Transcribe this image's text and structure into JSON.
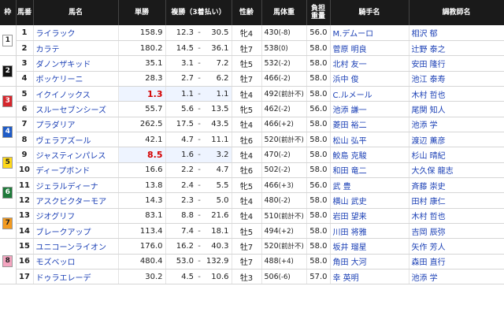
{
  "headers": {
    "waku": "枠",
    "umaban": "馬番",
    "horse": "馬名",
    "odds": "単勝",
    "place": "複勝（3着払い）",
    "sexage": "性齢",
    "weight": "馬体重",
    "kinryo_line1": "負担",
    "kinryo_line2": "重量",
    "jockey": "騎手名",
    "trainer": "調教師名"
  },
  "colors": {
    "waku1": "#ffffff",
    "waku2": "#111111",
    "waku3": "#d6262c",
    "waku4": "#1f5bc6",
    "waku5": "#ffd91a",
    "waku6": "#1f7a3a",
    "waku7": "#f39a1f",
    "waku8": "#f4a5c0"
  },
  "rows": [
    {
      "waku": "1",
      "waku_bg": "#ffffff",
      "waku_fg": "#222",
      "num": "1",
      "horse": "ライラック",
      "odds": "158.9",
      "p1": "12.3",
      "p2": "30.5",
      "sexage": "牝4",
      "w": "430",
      "wd": "(-8)",
      "kin": "56.0",
      "jockey": "M.デムーロ",
      "trainer": "相沢 郁",
      "red": false
    },
    {
      "waku": "",
      "waku_bg": "",
      "waku_fg": "",
      "num": "2",
      "horse": "カラテ",
      "odds": "180.2",
      "p1": "14.5",
      "p2": "36.1",
      "sexage": "牡7",
      "w": "538",
      "wd": "(0)",
      "kin": "58.0",
      "jockey": "菅原 明良",
      "trainer": "辻野 泰之",
      "red": false
    },
    {
      "waku": "2",
      "waku_bg": "#111111",
      "waku_fg": "#fff",
      "num": "3",
      "horse": "ダノンザキッド",
      "odds": "35.1",
      "p1": "3.1",
      "p2": "7.2",
      "sexage": "牡5",
      "w": "532",
      "wd": "(-2)",
      "kin": "58.0",
      "jockey": "北村 友一",
      "trainer": "安田 隆行",
      "red": false
    },
    {
      "waku": "",
      "waku_bg": "",
      "waku_fg": "",
      "num": "4",
      "horse": "ボッケリーニ",
      "odds": "28.3",
      "p1": "2.7",
      "p2": "6.2",
      "sexage": "牡7",
      "w": "466",
      "wd": "(-2)",
      "kin": "58.0",
      "jockey": "浜中 俊",
      "trainer": "池江 泰寿",
      "red": false
    },
    {
      "waku": "3",
      "waku_bg": "#d6262c",
      "waku_fg": "#fff",
      "num": "5",
      "horse": "イクイノックス",
      "odds": "1.3",
      "p1": "1.1",
      "p2": "1.1",
      "sexage": "牡4",
      "w": "492",
      "wd": "(前計不)",
      "kin": "58.0",
      "jockey": "C.ルメール",
      "trainer": "木村 哲也",
      "red": true
    },
    {
      "waku": "",
      "waku_bg": "",
      "waku_fg": "",
      "num": "6",
      "horse": "スルーセブンシーズ",
      "odds": "55.7",
      "p1": "5.6",
      "p2": "13.5",
      "sexage": "牝5",
      "w": "462",
      "wd": "(-2)",
      "kin": "56.0",
      "jockey": "池添 謙一",
      "trainer": "尾関 知人",
      "red": false
    },
    {
      "waku": "4",
      "waku_bg": "#1f5bc6",
      "waku_fg": "#fff",
      "num": "7",
      "horse": "プラダリア",
      "odds": "262.5",
      "p1": "17.5",
      "p2": "43.5",
      "sexage": "牡4",
      "w": "466",
      "wd": "(+2)",
      "kin": "58.0",
      "jockey": "菱田 裕二",
      "trainer": "池添 学",
      "red": false
    },
    {
      "waku": "",
      "waku_bg": "",
      "waku_fg": "",
      "num": "8",
      "horse": "ヴェラアズール",
      "odds": "42.1",
      "p1": "4.7",
      "p2": "11.1",
      "sexage": "牡6",
      "w": "520",
      "wd": "(前計不)",
      "kin": "58.0",
      "jockey": "松山 弘平",
      "trainer": "渡辺 薫彦",
      "red": false
    },
    {
      "waku": "5",
      "waku_bg": "#ffd91a",
      "waku_fg": "#222",
      "num": "9",
      "horse": "ジャスティンパレス",
      "odds": "8.5",
      "p1": "1.6",
      "p2": "3.2",
      "sexage": "牡4",
      "w": "470",
      "wd": "(-2)",
      "kin": "58.0",
      "jockey": "鮫島 克駿",
      "trainer": "杉山 晴紀",
      "red": true
    },
    {
      "waku": "",
      "waku_bg": "",
      "waku_fg": "",
      "num": "10",
      "horse": "ディープボンド",
      "odds": "16.6",
      "p1": "2.2",
      "p2": "4.7",
      "sexage": "牡6",
      "w": "502",
      "wd": "(-2)",
      "kin": "58.0",
      "jockey": "和田 竜二",
      "trainer": "大久保 龍志",
      "red": false
    },
    {
      "waku": "6",
      "waku_bg": "#1f7a3a",
      "waku_fg": "#fff",
      "num": "11",
      "horse": "ジェラルディーナ",
      "odds": "13.8",
      "p1": "2.4",
      "p2": "5.5",
      "sexage": "牝5",
      "w": "466",
      "wd": "(+3)",
      "kin": "56.0",
      "jockey": "武 豊",
      "trainer": "斉藤 崇史",
      "red": false
    },
    {
      "waku": "",
      "waku_bg": "",
      "waku_fg": "",
      "num": "12",
      "horse": "アスクビクターモア",
      "odds": "14.3",
      "p1": "2.3",
      "p2": "5.0",
      "sexage": "牡4",
      "w": "480",
      "wd": "(-2)",
      "kin": "58.0",
      "jockey": "横山 武史",
      "trainer": "田村 康仁",
      "red": false
    },
    {
      "waku": "7",
      "waku_bg": "#f39a1f",
      "waku_fg": "#222",
      "num": "13",
      "horse": "ジオグリフ",
      "odds": "83.1",
      "p1": "8.8",
      "p2": "21.6",
      "sexage": "牡4",
      "w": "510",
      "wd": "(前計不)",
      "kin": "58.0",
      "jockey": "岩田 望来",
      "trainer": "木村 哲也",
      "red": false
    },
    {
      "waku": "",
      "waku_bg": "",
      "waku_fg": "",
      "num": "14",
      "horse": "ブレークアップ",
      "odds": "113.4",
      "p1": "7.4",
      "p2": "18.1",
      "sexage": "牡5",
      "w": "494",
      "wd": "(+2)",
      "kin": "58.0",
      "jockey": "川田 将雅",
      "trainer": "吉岡 辰弥",
      "red": false
    },
    {
      "waku": "8",
      "waku_bg": "#f4a5c0",
      "waku_fg": "#222",
      "num": "15",
      "horse": "ユニコーンライオン",
      "odds": "176.0",
      "p1": "16.2",
      "p2": "40.3",
      "sexage": "牡7",
      "w": "520",
      "wd": "(前計不)",
      "kin": "58.0",
      "jockey": "坂井 瑠星",
      "trainer": "矢作 芳人",
      "red": false
    },
    {
      "waku": "",
      "waku_bg": "",
      "waku_fg": "",
      "num": "16",
      "horse": "モズベッロ",
      "odds": "480.4",
      "p1": "53.0",
      "p2": "132.9",
      "sexage": "牡7",
      "w": "488",
      "wd": "(+4)",
      "kin": "58.0",
      "jockey": "角田 大河",
      "trainer": "森田 直行",
      "red": false
    },
    {
      "waku": "",
      "waku_bg": "",
      "waku_fg": "",
      "num": "17",
      "horse": "ドゥラエレーデ",
      "odds": "30.2",
      "p1": "4.5",
      "p2": "10.6",
      "sexage": "牡3",
      "w": "506",
      "wd": "(-6)",
      "kin": "57.0",
      "jockey": "幸 英明",
      "trainer": "池添 学",
      "red": false
    }
  ]
}
